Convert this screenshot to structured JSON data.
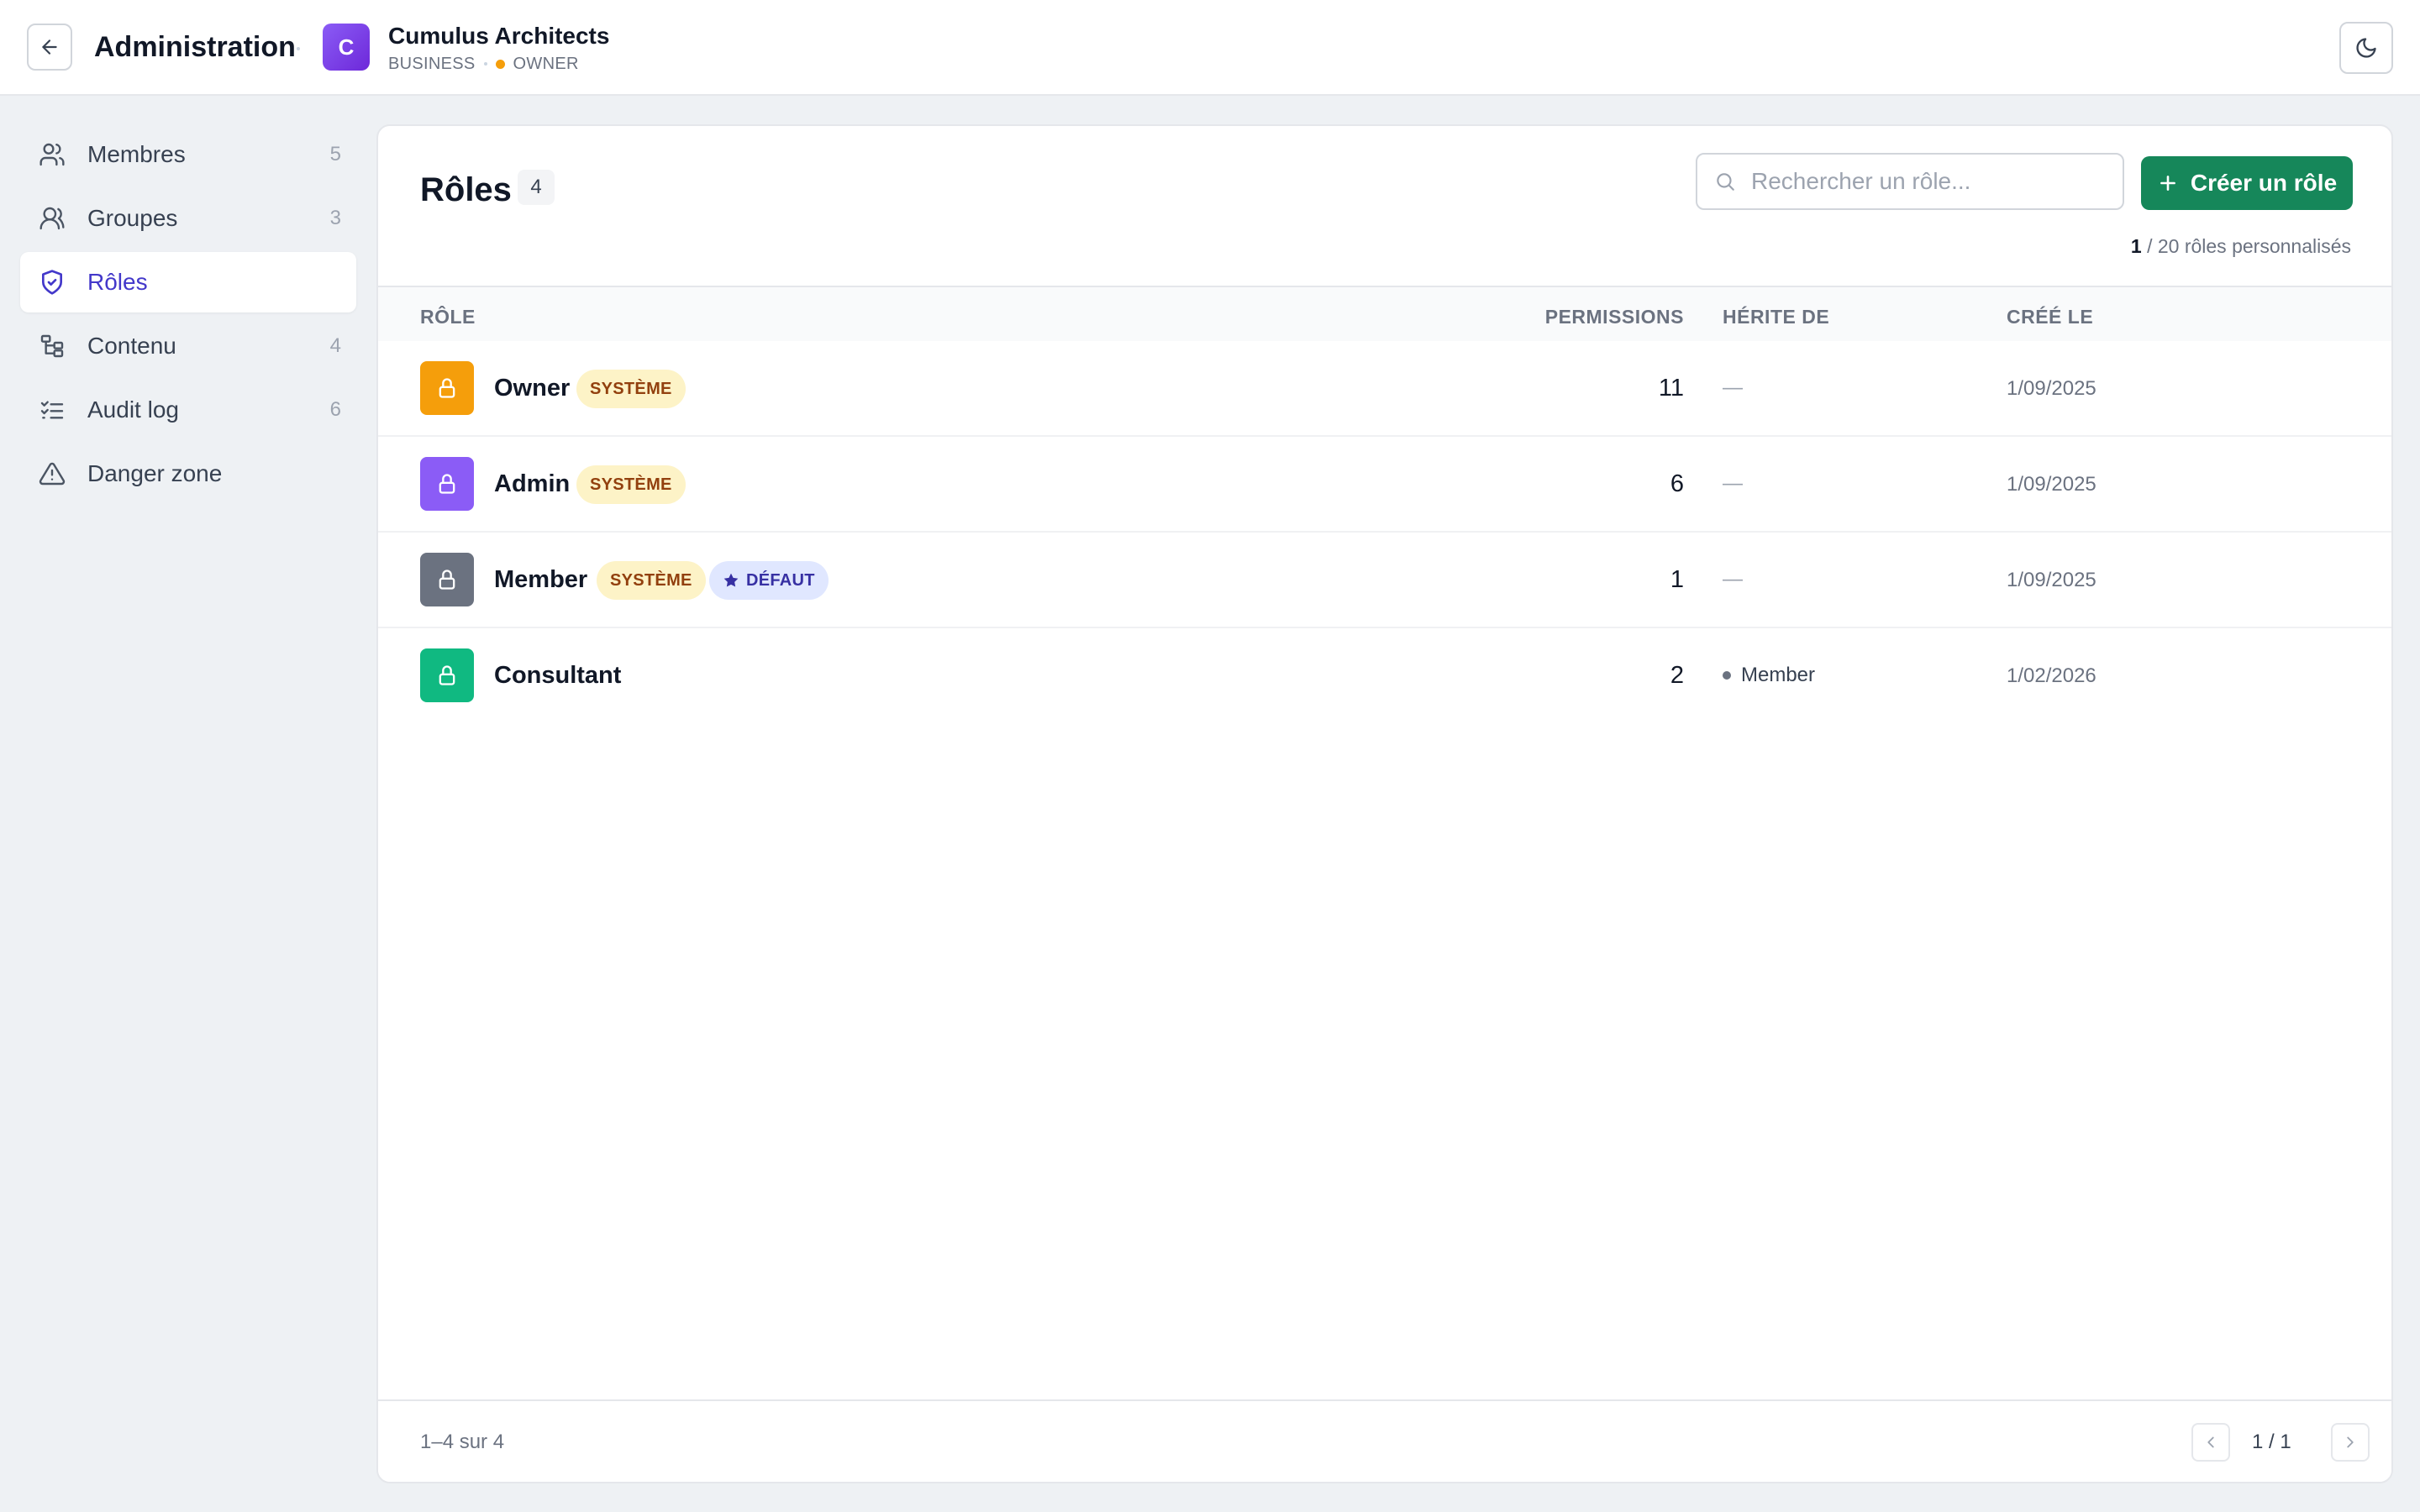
{
  "header": {
    "title": "Administration",
    "org": {
      "initial": "C",
      "name": "Cumulus Architects",
      "plan": "BUSINESS",
      "role": "OWNER"
    }
  },
  "sidebar": {
    "items": [
      {
        "label": "Membres",
        "count": "5",
        "icon": "users-icon"
      },
      {
        "label": "Groupes",
        "count": "3",
        "icon": "user-group-icon"
      },
      {
        "label": "Rôles",
        "count": "",
        "icon": "shield-icon",
        "active": true
      },
      {
        "label": "Contenu",
        "count": "4",
        "icon": "tree-icon"
      },
      {
        "label": "Audit log",
        "count": "6",
        "icon": "checklist-icon"
      },
      {
        "label": "Danger zone",
        "count": "",
        "icon": "warning-icon"
      }
    ]
  },
  "main": {
    "title": "Rôles",
    "count": "4",
    "search_placeholder": "Rechercher un rôle...",
    "create_label": "Créer un rôle",
    "quota": {
      "used": "1",
      "rest": " / 20 rôles personnalisés"
    },
    "columns": {
      "role": "RÔLE",
      "permissions": "PERMISSIONS",
      "inherits": "HÉRITE DE",
      "created": "CRÉÉ LE"
    },
    "rows": [
      {
        "name": "Owner",
        "system_tag": "SYSTÈME",
        "default_tag": "",
        "permissions": "11",
        "inherits": "—",
        "created": "1/09/2025",
        "color": "#f59e0b"
      },
      {
        "name": "Admin",
        "system_tag": "SYSTÈME",
        "default_tag": "",
        "permissions": "6",
        "inherits": "—",
        "created": "1/09/2025",
        "color": "#8b5cf6"
      },
      {
        "name": "Member",
        "system_tag": "SYSTÈME",
        "default_tag": "DÉFAUT",
        "permissions": "1",
        "inherits": "—",
        "created": "1/09/2025",
        "color": "#6b7280"
      },
      {
        "name": "Consultant",
        "system_tag": "",
        "default_tag": "",
        "permissions": "2",
        "inherits": "Member",
        "created": "1/02/2026",
        "color": "#10b981"
      }
    ],
    "footer": {
      "range": "1–4 sur 4",
      "page": "1 / 1"
    }
  }
}
